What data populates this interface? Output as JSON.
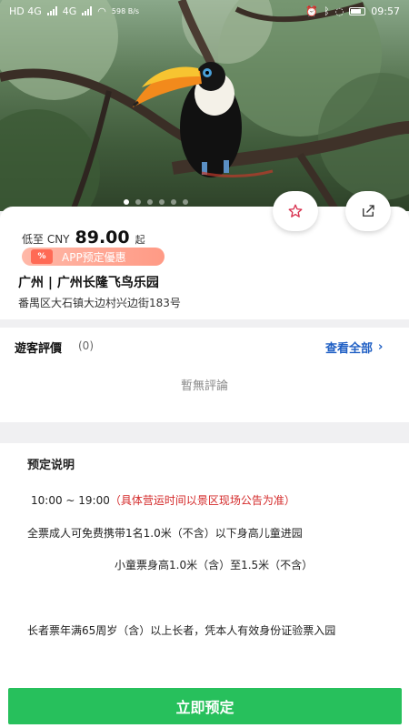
{
  "status_bar": {
    "carrier": "HD 4G",
    "network": "4G",
    "speed": "598 B/s",
    "time": "09:57"
  },
  "hero": {
    "carousel_total": 6,
    "carousel_active_index": 0
  },
  "actions": {
    "favorite_icon": "star-outline-icon",
    "share_icon": "share-icon"
  },
  "price": {
    "prefix": "低至 CNY",
    "value": "89.00",
    "suffix": "起"
  },
  "promo": {
    "icon_text": "%",
    "label": "APP预定優惠"
  },
  "park": {
    "name": "广州 | 广州长隆飞鸟乐园",
    "address": "番禺区大石镇大边村兴边街183号"
  },
  "reviews": {
    "title": "遊客評價",
    "count": "(0)",
    "view_all": "查看全部",
    "empty_text": "暫無評論"
  },
  "booking_notes": {
    "title": "预定说明",
    "hours": "10:00 ~ 19:00",
    "hours_hint": "（具体营运时间以景区现场公告为准）",
    "child_policy": "全票成人可免费携带1名1.0米（不含）以下身高儿童进园",
    "child_ticket": "小童票身高1.0米（含）至1.5米（不含）",
    "senior_ticket": "长者票年满65周岁（含）以上长者，凭本人有效身份证验票入园"
  },
  "cta": {
    "label": "立即预定",
    "color": "#27c05c"
  },
  "colors": {
    "link_blue": "#1f5fc4",
    "warning_red": "#d42a2a",
    "promo_pink": "#ff9a85"
  }
}
